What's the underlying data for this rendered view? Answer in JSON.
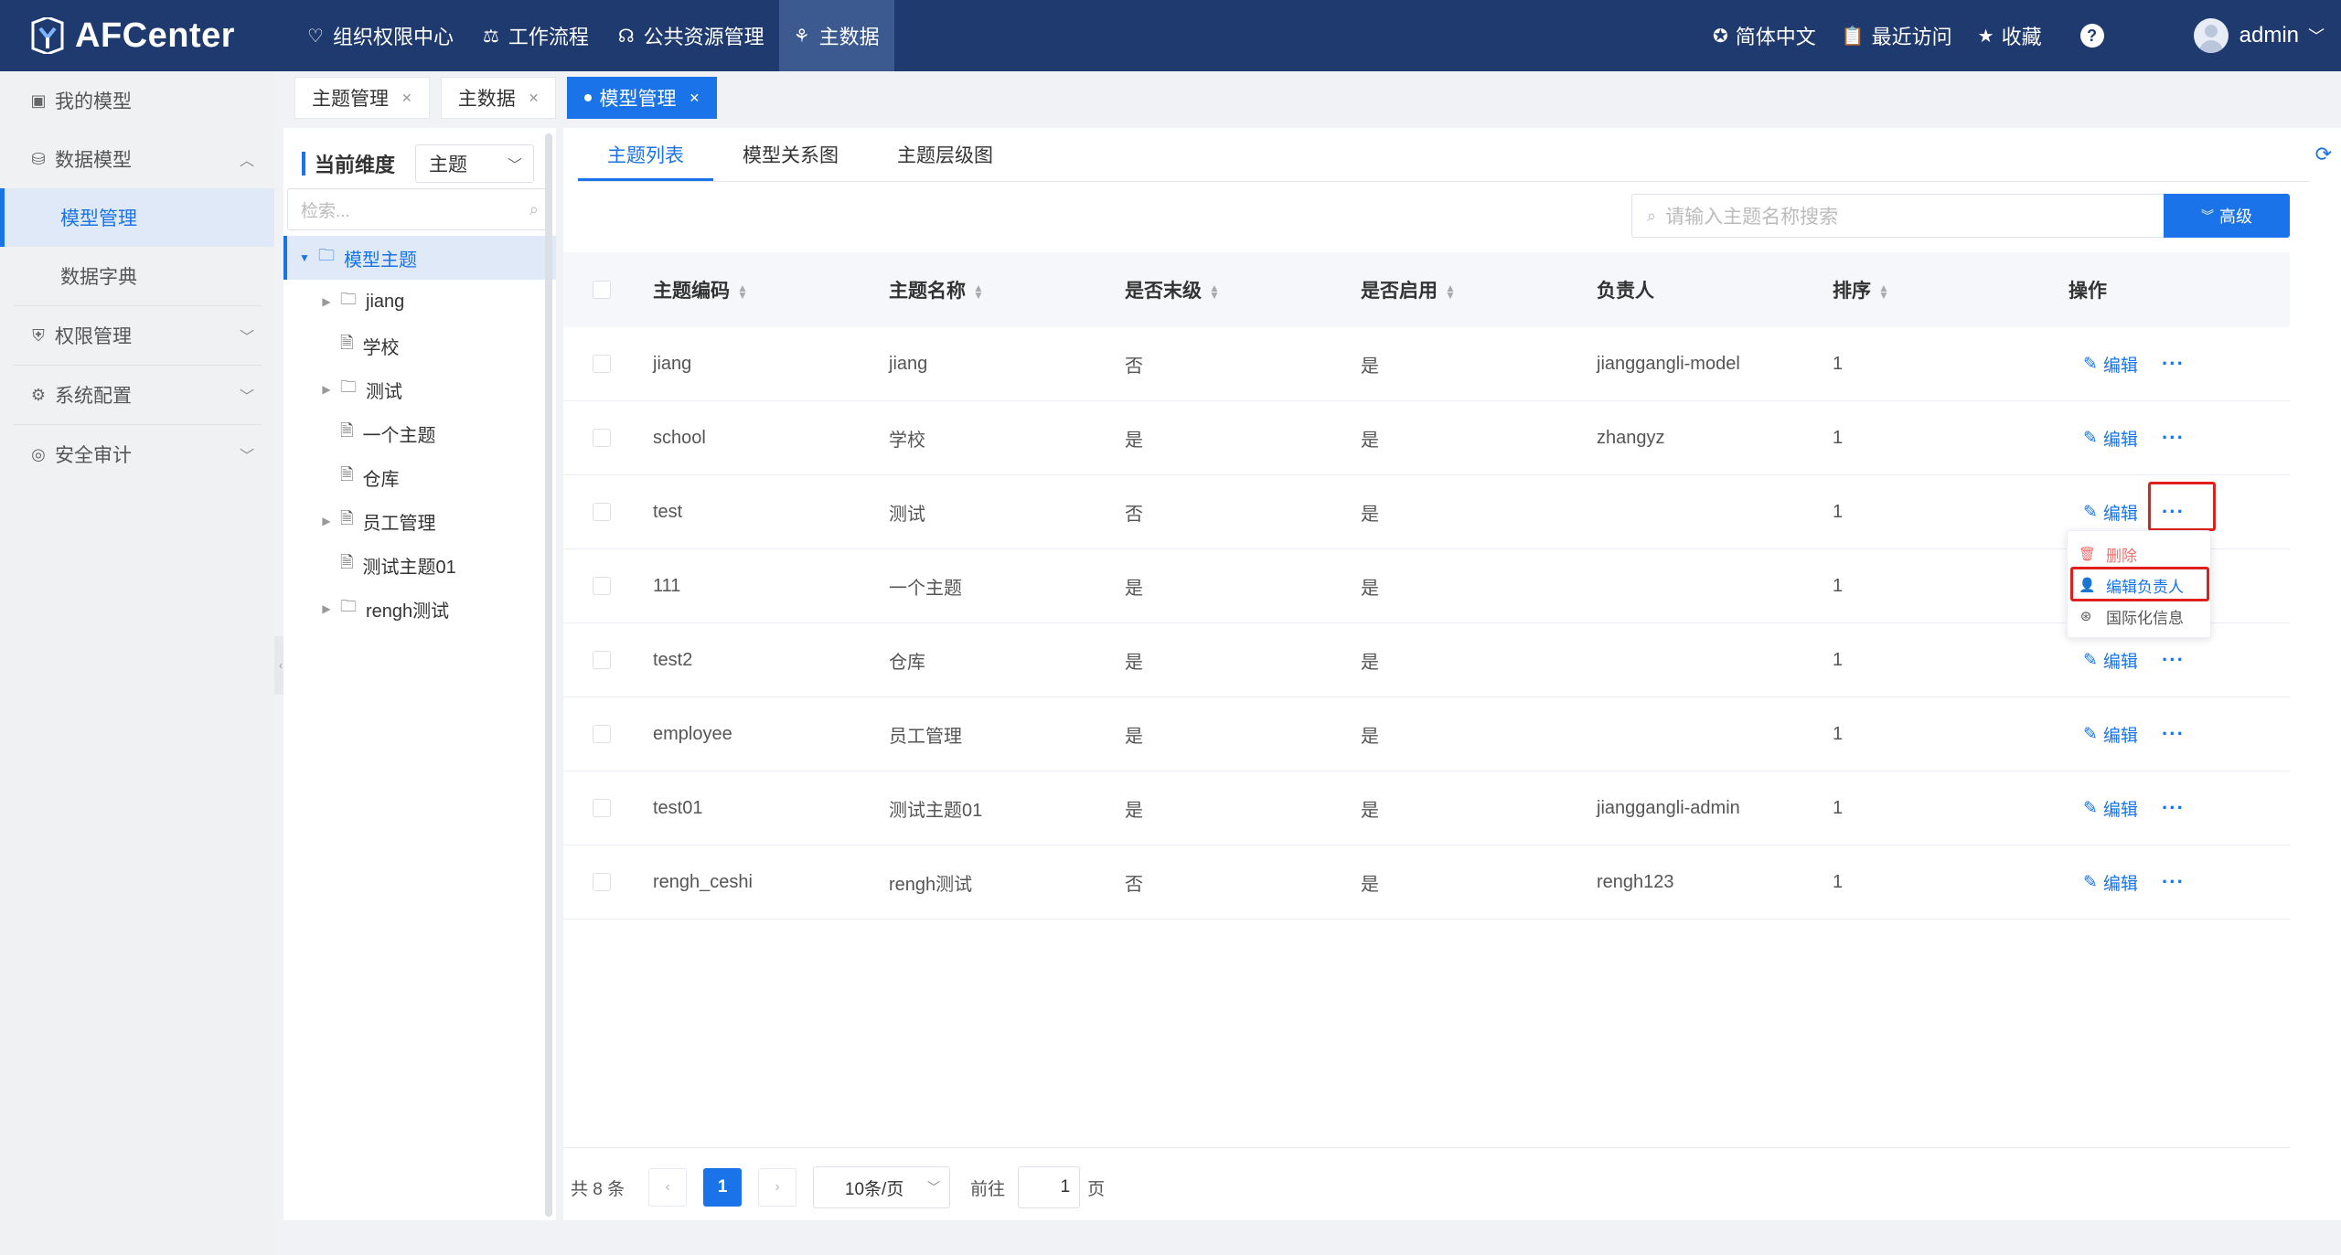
{
  "header": {
    "logo": "AFCenter",
    "nav": [
      {
        "label": "组织权限中心",
        "icon": "shield-icon"
      },
      {
        "label": "工作流程",
        "icon": "scale-icon"
      },
      {
        "label": "公共资源管理",
        "icon": "resource-icon"
      },
      {
        "label": "主数据",
        "icon": "masterdata-icon",
        "active": true
      }
    ],
    "language": "简体中文",
    "recent": "最近访问",
    "favorites": "收藏",
    "help": "?",
    "user": "admin"
  },
  "sidebar": {
    "items": [
      {
        "label": "我的模型",
        "icon": "model-icon"
      },
      {
        "label": "数据模型",
        "icon": "database-icon",
        "expanded": true
      },
      {
        "label": "模型管理",
        "sub": true,
        "active": true
      },
      {
        "label": "数据字典",
        "sub": true
      },
      {
        "label": "权限管理",
        "icon": "permission-icon"
      },
      {
        "label": "系统配置",
        "icon": "gear-icon"
      },
      {
        "label": "安全审计",
        "icon": "audit-icon"
      }
    ]
  },
  "tabs": [
    {
      "label": "主题管理"
    },
    {
      "label": "主数据"
    },
    {
      "label": "模型管理",
      "active": true
    }
  ],
  "tree_panel": {
    "dimension_label": "当前维度",
    "dimension_value": "主题",
    "search_placeholder": "检索...",
    "nodes": [
      {
        "label": "模型主题",
        "level": 0,
        "type": "folder",
        "expandable": true
      },
      {
        "label": "jiang",
        "level": 1,
        "type": "folder",
        "expandable": true
      },
      {
        "label": "学校",
        "level": 1,
        "type": "file",
        "expandable": false
      },
      {
        "label": "测试",
        "level": 1,
        "type": "folder",
        "expandable": true
      },
      {
        "label": "一个主题",
        "level": 1,
        "type": "file",
        "expandable": false
      },
      {
        "label": "仓库",
        "level": 1,
        "type": "file",
        "expandable": false
      },
      {
        "label": "员工管理",
        "level": 1,
        "type": "file",
        "expandable": true
      },
      {
        "label": "测试主题01",
        "level": 1,
        "type": "file",
        "expandable": false
      },
      {
        "label": "rengh测试",
        "level": 1,
        "type": "folder",
        "expandable": true
      }
    ]
  },
  "main": {
    "subtabs": [
      "主题列表",
      "模型关系图",
      "主题层级图"
    ],
    "search_placeholder": "请输入主题名称搜索",
    "advanced": "高级",
    "columns": [
      "主题编码",
      "主题名称",
      "是否末级",
      "是否启用",
      "负责人",
      "排序",
      "操作"
    ],
    "edit_label": "编辑",
    "rows": [
      {
        "code": "jiang",
        "name": "jiang",
        "leaf": "否",
        "enabled": "是",
        "owner": "jianggangli-model",
        "order": "1"
      },
      {
        "code": "school",
        "name": "学校",
        "leaf": "是",
        "enabled": "是",
        "owner": "zhangyz",
        "order": "1"
      },
      {
        "code": "test",
        "name": "测试",
        "leaf": "否",
        "enabled": "是",
        "owner": "",
        "order": "1"
      },
      {
        "code": "111",
        "name": "一个主题",
        "leaf": "是",
        "enabled": "是",
        "owner": "",
        "order": "1"
      },
      {
        "code": "test2",
        "name": "仓库",
        "leaf": "是",
        "enabled": "是",
        "owner": "",
        "order": "1"
      },
      {
        "code": "employee",
        "name": "员工管理",
        "leaf": "是",
        "enabled": "是",
        "owner": "",
        "order": "1"
      },
      {
        "code": "test01",
        "name": "测试主题01",
        "leaf": "是",
        "enabled": "是",
        "owner": "jianggangli-admin",
        "order": "1"
      },
      {
        "code": "rengh_ceshi",
        "name": "rengh测试",
        "leaf": "否",
        "enabled": "是",
        "owner": "rengh123",
        "order": "1"
      }
    ],
    "dropdown": [
      {
        "label": "删除",
        "icon": "trash-icon"
      },
      {
        "label": "编辑负责人",
        "icon": "user-icon"
      },
      {
        "label": "国际化信息",
        "icon": "globe-icon"
      }
    ],
    "pager": {
      "total": "共 8 条",
      "current": "1",
      "size": "10条/页",
      "goto": "前往",
      "goto_value": "1",
      "page_unit": "页"
    }
  }
}
